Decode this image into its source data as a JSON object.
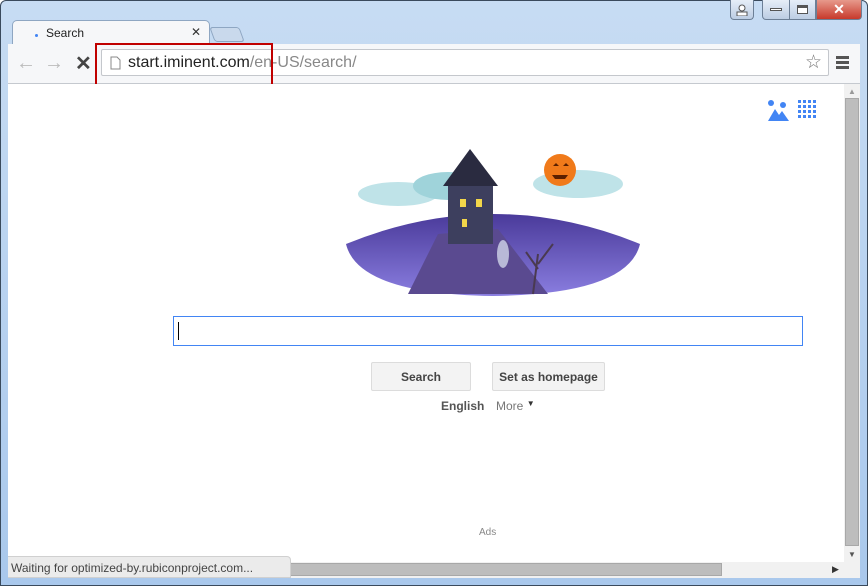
{
  "tab": {
    "title": "Search"
  },
  "address": {
    "host": "start.iminent.com",
    "path": "/en-US/search/"
  },
  "search": {
    "value": "",
    "button": "Search",
    "homepage_button": "Set as homepage"
  },
  "language": {
    "current": "English",
    "more": "More"
  },
  "ads_label": "Ads",
  "status": "Waiting for optimized-by.rubiconproject.com...",
  "colors": {
    "accent": "#4285f4",
    "highlight_box": "#c00000",
    "close": "#c7392b"
  }
}
